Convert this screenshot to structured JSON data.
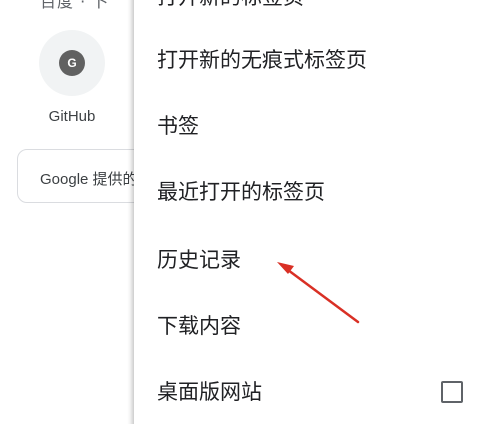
{
  "background": {
    "top_label": "百度 · 卜",
    "shortcut": {
      "label": "GitHub",
      "icon_letter": "G"
    },
    "search_box": {
      "text": "Google 提供的"
    }
  },
  "menu": {
    "items": [
      {
        "label": "打开新的标签页"
      },
      {
        "label": "打开新的无痕式标签页"
      },
      {
        "label": "书签"
      },
      {
        "label": "最近打开的标签页"
      },
      {
        "label": "历史记录"
      },
      {
        "label": "下载内容"
      },
      {
        "label": "桌面版网站",
        "checkbox": {
          "checked": false
        }
      }
    ]
  },
  "annotation": {
    "arrow_color": "#d93025",
    "points_to": "历史记录"
  }
}
